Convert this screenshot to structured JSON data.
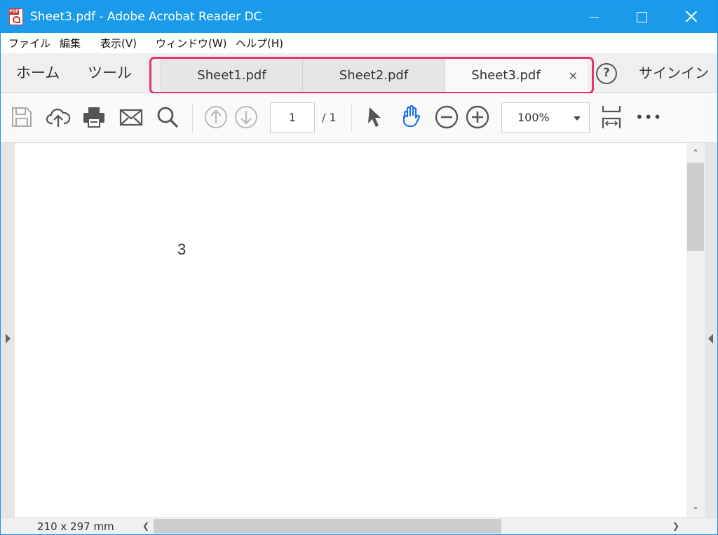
{
  "window": {
    "title": "Sheet3.pdf - Adobe Acrobat Reader DC"
  },
  "menu": {
    "items": [
      "ファイル",
      "編集",
      "表示(V)",
      "ウィンドウ(W)",
      "ヘルプ(H)"
    ]
  },
  "nav": {
    "home": "ホーム",
    "tools": "ツール",
    "tabs": [
      {
        "label": "Sheet1.pdf",
        "active": false
      },
      {
        "label": "Sheet2.pdf",
        "active": false
      },
      {
        "label": "Sheet3.pdf",
        "active": true
      }
    ],
    "tab_close": "×",
    "help": "?",
    "signin": "サインイン"
  },
  "toolbar": {
    "page_current": "1",
    "page_total": "/  1",
    "zoom": "100%",
    "more": "•••",
    "icons": [
      "save-icon",
      "cloud-upload-icon",
      "print-icon",
      "mail-icon",
      "search-icon",
      "page-up-icon",
      "page-down-icon",
      "select-cursor-icon",
      "hand-icon",
      "zoom-out-icon",
      "zoom-in-icon",
      "fit-width-icon",
      "more-icon"
    ]
  },
  "document": {
    "content": "3"
  },
  "status": {
    "page_size": "210 x 297 mm"
  },
  "colors": {
    "titlebar": "#1a9ae8",
    "highlight": "#e8336b",
    "hand_tool": "#1a73e8"
  }
}
